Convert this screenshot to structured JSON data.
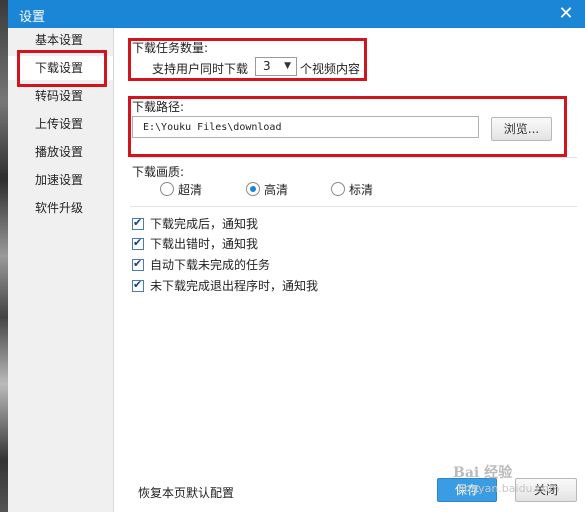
{
  "window": {
    "title": "设置",
    "close_glyph": "✕"
  },
  "sidebar": {
    "items": [
      {
        "label": "基本设置"
      },
      {
        "label": "下载设置"
      },
      {
        "label": "转码设置"
      },
      {
        "label": "上传设置"
      },
      {
        "label": "播放设置"
      },
      {
        "label": "加速设置"
      },
      {
        "label": "软件升级"
      }
    ],
    "active_index": 1
  },
  "download": {
    "task_count_label": "下载任务数量:",
    "task_prefix": "支持用户同时下载",
    "task_value": "3",
    "task_suffix": "个视频内容",
    "path_label": "下载路径:",
    "path_value": "E:\\Youku Files\\download",
    "browse_label": "浏览...",
    "quality_label": "下载画质:",
    "quality_options": [
      {
        "label": "超清",
        "selected": false
      },
      {
        "label": "高清",
        "selected": true
      },
      {
        "label": "标清",
        "selected": false
      }
    ],
    "checkboxes": [
      {
        "label": "下载完成后，通知我",
        "checked": true
      },
      {
        "label": "下载出错时，通知我",
        "checked": true
      },
      {
        "label": "自动下载未完成的任务",
        "checked": true
      },
      {
        "label": "未下载完成退出程序时，通知我",
        "checked": true
      }
    ]
  },
  "footer": {
    "restore_label": "恢复本页默认配置",
    "save_label": "保存",
    "close_label": "关闭"
  },
  "watermark": {
    "brand": "Bai 经验",
    "url": "jingyan.baidu.com"
  },
  "colors": {
    "accent": "#1b86d6",
    "highlight_box": "#d2141e"
  }
}
